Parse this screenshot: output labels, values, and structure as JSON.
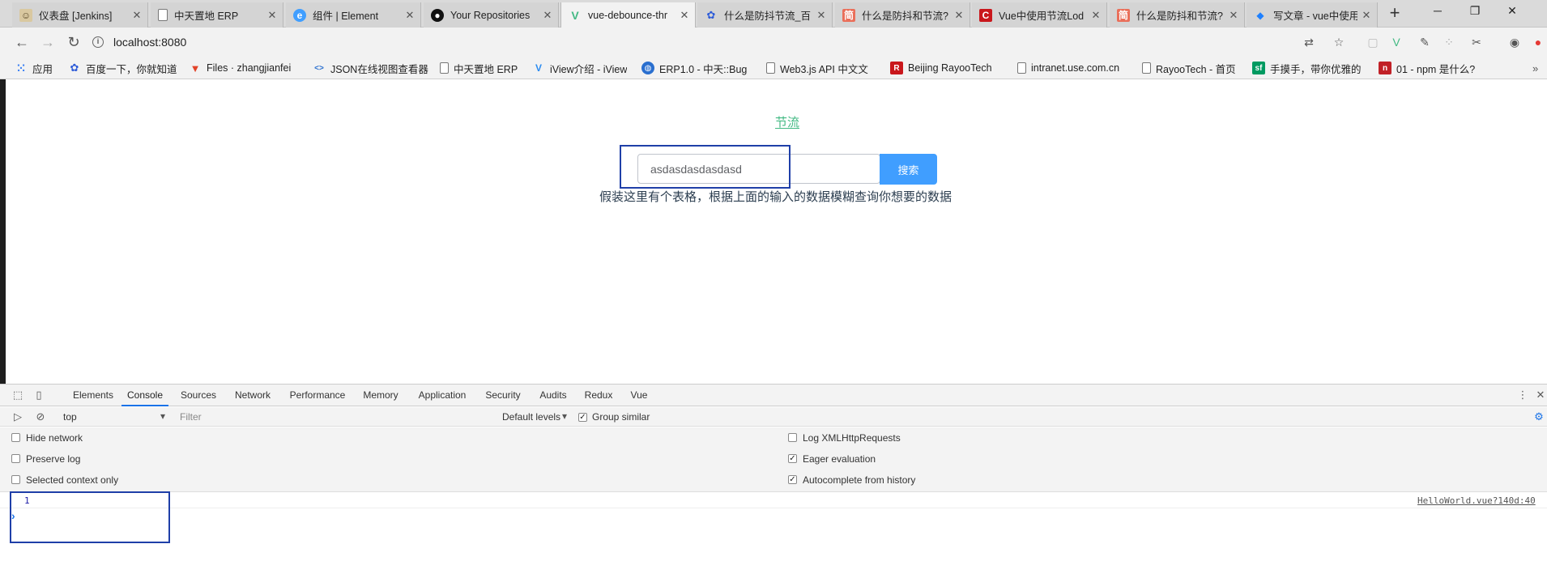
{
  "tabs": [
    {
      "title": "仪表盘 [Jenkins]",
      "icon": "jenkins-icon"
    },
    {
      "title": "中天置地 ERP",
      "icon": "page-icon"
    },
    {
      "title": "组件 | Element",
      "icon": "element-icon"
    },
    {
      "title": "Your Repositories",
      "icon": "github-icon"
    },
    {
      "title": "vue-debounce-thr",
      "icon": "vue-icon"
    },
    {
      "title": "什么是防抖节流_百",
      "icon": "baidu-icon"
    },
    {
      "title": "什么是防抖和节流?",
      "icon": "jianshu-icon"
    },
    {
      "title": "Vue中使用节流Lod",
      "icon": "csdn-icon"
    },
    {
      "title": "什么是防抖和节流?",
      "icon": "jianshu-icon"
    },
    {
      "title": "写文章 - vue中使用",
      "icon": "juejin-icon"
    }
  ],
  "address": {
    "url": "localhost:8080"
  },
  "bookmarks": [
    {
      "label": "应用",
      "icon": "apps-icon"
    },
    {
      "label": "百度一下，你就知道",
      "icon": "baidu-icon"
    },
    {
      "label": "Files · zhangjianfei",
      "icon": "gitlab-icon"
    },
    {
      "label": "JSON在线视图查看器",
      "icon": "json-icon"
    },
    {
      "label": "中天置地 ERP",
      "icon": "page-icon"
    },
    {
      "label": "iView介绍 - iView",
      "icon": "iview-icon"
    },
    {
      "label": "ERP1.0 - 中天::Bug",
      "icon": "globe-icon"
    },
    {
      "label": "Web3.js API 中文文",
      "icon": "page-icon"
    },
    {
      "label": "Beijing RayooTech",
      "icon": "rayoo-icon"
    },
    {
      "label": "intranet.use.com.cn",
      "icon": "page-icon"
    },
    {
      "label": "RayooTech - 首页",
      "icon": "page-icon"
    },
    {
      "label": "手摸手，带你优雅的",
      "icon": "segmentfault-icon"
    },
    {
      "label": "01 - npm 是什么?",
      "icon": "npm-icon"
    }
  ],
  "page": {
    "title": "节流",
    "search_value": "asdasdasdasdasd",
    "search_button": "搜索",
    "hint": "假装这里有个表格，根据上面的输入的数据模糊查询你想要的数据"
  },
  "devtools": {
    "tabs": [
      "Elements",
      "Console",
      "Sources",
      "Network",
      "Performance",
      "Memory",
      "Application",
      "Security",
      "Audits",
      "Redux",
      "Vue"
    ],
    "active_tab": "Console",
    "context": "top",
    "filter_placeholder": "Filter",
    "levels": "Default levels",
    "group_similar": {
      "label": "Group similar",
      "checked": true
    },
    "settings_left": [
      {
        "label": "Hide network",
        "checked": false
      },
      {
        "label": "Preserve log",
        "checked": false
      },
      {
        "label": "Selected context only",
        "checked": false
      }
    ],
    "settings_right": [
      {
        "label": "Log XMLHttpRequests",
        "checked": false
      },
      {
        "label": "Eager evaluation",
        "checked": true
      },
      {
        "label": "Autocomplete from history",
        "checked": true
      }
    ],
    "console": {
      "log_value": "1",
      "log_source": "HelloWorld.vue?140d:40",
      "prompt": "›"
    }
  },
  "colors": {
    "accent_green": "#42b983",
    "button_blue": "#409eff",
    "highlight_box": "#1f3fa8"
  }
}
